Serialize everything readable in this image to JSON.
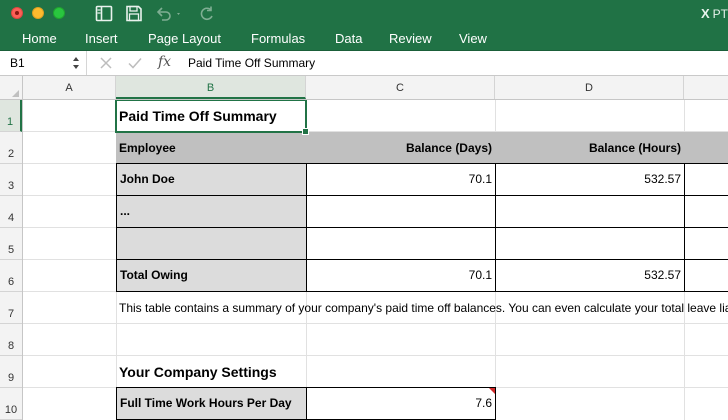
{
  "window": {
    "doc_badge": "PT"
  },
  "icons": {
    "sidebar": "sidebar-toggle-icon",
    "save": "save-icon",
    "undo": "undo-icon",
    "redo": "redo-icon",
    "cancel": "cancel-x-icon",
    "enter": "enter-check-icon",
    "function": "function-fx-icon"
  },
  "ribbon": {
    "tabs": [
      {
        "label": "Home"
      },
      {
        "label": "Insert"
      },
      {
        "label": "Page Layout"
      },
      {
        "label": "Formulas"
      },
      {
        "label": "Data"
      },
      {
        "label": "Review"
      },
      {
        "label": "View"
      }
    ]
  },
  "formula_bar": {
    "name_box": "B1",
    "fx_label": "fx",
    "content": "Paid Time Off Summary"
  },
  "grid": {
    "columns": [
      "A",
      "B",
      "C",
      "D"
    ],
    "rows": [
      "1",
      "2",
      "3",
      "4",
      "5",
      "6",
      "7",
      "8",
      "9",
      "10"
    ],
    "selected_cell": "B1"
  },
  "sheet": {
    "title": "Paid Time Off Summary",
    "table": {
      "headers": [
        "Employee",
        "Balance (Days)",
        "Balance (Hours)"
      ],
      "rows": [
        [
          "John Doe",
          "70.1",
          "532.57"
        ],
        [
          "...",
          "",
          ""
        ],
        [
          "",
          "",
          ""
        ]
      ],
      "total": [
        "Total Owing",
        "70.1",
        "532.57"
      ]
    },
    "note": "This table contains a summary of your company's paid time off balances. You can even calculate your total leave liability.",
    "settings": {
      "title": "Your Company Settings",
      "rows": [
        [
          "Full Time Work Hours Per Day",
          "7.6"
        ]
      ]
    }
  },
  "colors": {
    "ribbon_green": "#207245",
    "selection_green": "#217346",
    "header_gray": "#c0c0c0",
    "label_gray": "#dcdcdc",
    "comment_red": "#d22a2a"
  }
}
